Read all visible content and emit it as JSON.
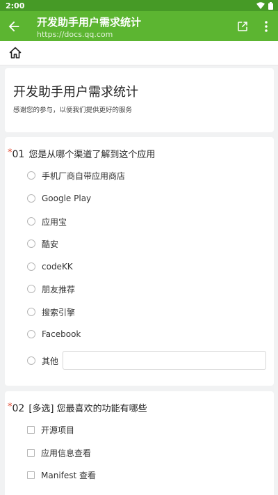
{
  "status_bar": {
    "time": "2:00",
    "icons": [
      "wifi-icon",
      "battery-icon"
    ]
  },
  "app_bar": {
    "title": "开发助手用户需求统计",
    "url": "https://docs.qq.com",
    "icons": [
      "back-arrow-icon",
      "share-icon",
      "more-vert-icon"
    ]
  },
  "toolbar": {
    "icons": [
      "home-icon"
    ]
  },
  "form": {
    "title": "开发助手用户需求统计",
    "description": "感谢您的参与，以便我们提供更好的服务"
  },
  "questions": [
    {
      "required": "*",
      "number": "01",
      "text": "您是从哪个渠道了解到这个应用",
      "type": "radio",
      "options": [
        "手机厂商自带应用商店",
        "Google Play",
        "应用宝",
        "酷安",
        "codeKK",
        "朋友推荐",
        "搜索引擎",
        "Facebook",
        "其他"
      ],
      "other_value": ""
    },
    {
      "required": "*",
      "number": "02",
      "text": "[多选] 您最喜欢的功能有哪些",
      "type": "checkbox",
      "options": [
        "开源项目",
        "应用信息查看",
        "Manifest 查看"
      ]
    }
  ],
  "colors": {
    "status_bar": "#469a26",
    "app_bar": "#5cb531",
    "page_bg": "#f1f2f3",
    "required_star": "#e0472f"
  }
}
